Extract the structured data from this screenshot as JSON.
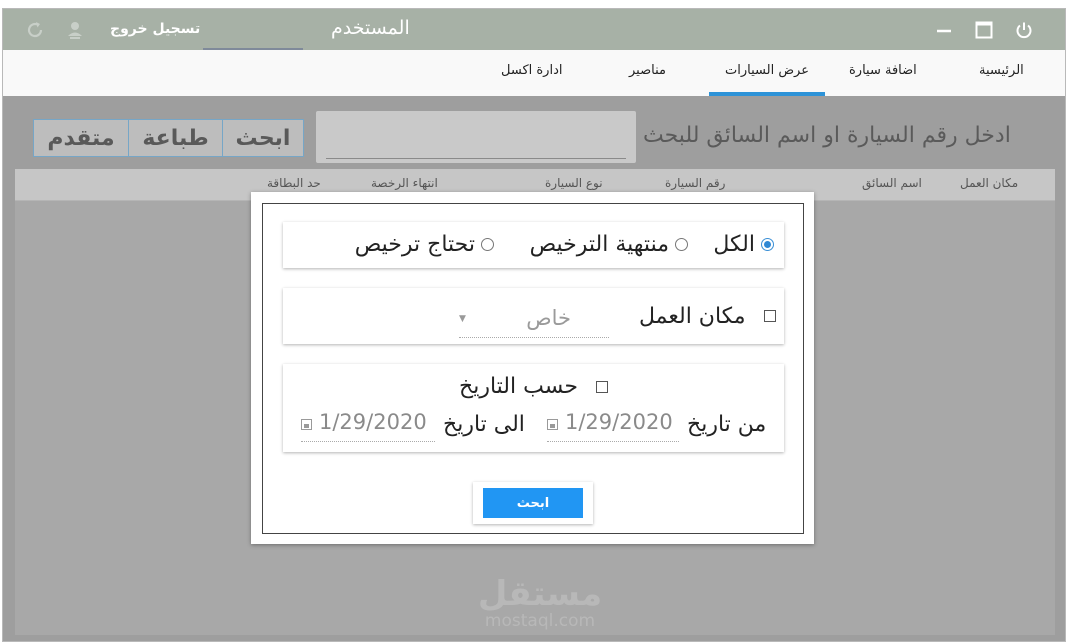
{
  "titlebar": {
    "user_title": "المستخدم",
    "logout_label": "تسجيل خروج",
    "icons": [
      "power-icon",
      "maximize-icon",
      "minimize-icon",
      "user-sync-icon",
      "refresh-icon"
    ]
  },
  "nav": {
    "tabs": [
      {
        "label": "الرئيسية"
      },
      {
        "label": "اضافة سيارة"
      },
      {
        "label": "عرض السيارات"
      },
      {
        "label": "مناصير"
      },
      {
        "label": "ادارة اكسل"
      }
    ],
    "active_tab": "عرض السيارات"
  },
  "search": {
    "label": "ادخل رقم السيارة او اسم السائق للبحث",
    "value": "",
    "search_button": "ابحث",
    "print_button": "طباعة",
    "advanced_button": "متقدم"
  },
  "table": {
    "columns": [
      "مكان العمل",
      "اسم السائق",
      "رقم السيارة",
      "نوع السيارة",
      "انتهاء الرخصة",
      "حد البطاقة"
    ]
  },
  "dialog": {
    "filter_options": [
      {
        "label": "الكل",
        "selected": true
      },
      {
        "label": "منتهية الترخيص",
        "selected": false
      },
      {
        "label": "تحتاج ترخيص",
        "selected": false
      }
    ],
    "workplace": {
      "label": "مكان العمل",
      "checked": false,
      "selected_value": "خاص"
    },
    "by_date": {
      "label": "حسب التاريخ",
      "checked": false,
      "from_label": "من تاريخ",
      "from_value": "1/29/2020",
      "to_label": "الى تاريخ",
      "to_value": "1/29/2020"
    },
    "search_button": "ابحث"
  },
  "watermark": {
    "arabic": "مستقل",
    "latin": "mostaql.com"
  },
  "colors": {
    "titlebar": "#a7b1a6",
    "accent": "#2d93d8",
    "button_blue": "#2196f3"
  }
}
